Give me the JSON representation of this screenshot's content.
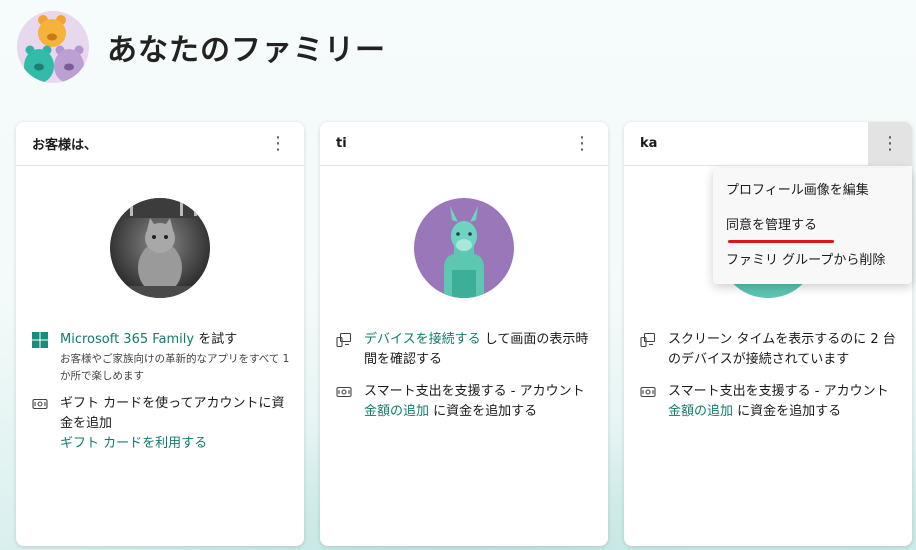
{
  "header": {
    "title": "あなたのファミリー"
  },
  "cards": [
    {
      "name": "お客様は、",
      "more_icon": "⋮",
      "rows": [
        {
          "link": "Microsoft 365 Family",
          "text": " を試す",
          "sub": "お客様やご家族向けの革新的なアプリをすべて 1 か所で楽しめます"
        },
        {
          "text": "ギフト カードを使ってアカウントに資金を追加",
          "link": "ギフト カードを利用する"
        }
      ]
    },
    {
      "name": "ti",
      "more_icon": "⋮",
      "rows": [
        {
          "link": "デバイスを接続する",
          "text": " して画面の表示時間を確認する"
        },
        {
          "text": "スマート支出を支援する - アカウント",
          "link": "金額の追加",
          "text2": " に資金を追加する"
        }
      ]
    },
    {
      "name": "ka",
      "more_icon": "⋮",
      "rows": [
        {
          "text": "スクリーン タイムを表示するのに 2 台のデバイスが接続されています"
        },
        {
          "text": "スマート支出を支援する - アカウント",
          "link": "金額の追加",
          "text2": " に資金を追加する"
        }
      ]
    }
  ],
  "menu": {
    "items": [
      "プロフィール画像を編集",
      "同意を管理する",
      "ファミリ グループから削除"
    ]
  },
  "colors": {
    "link": "#107c6c",
    "underline": "#e01515",
    "accent_purple": "#9a77b8"
  }
}
